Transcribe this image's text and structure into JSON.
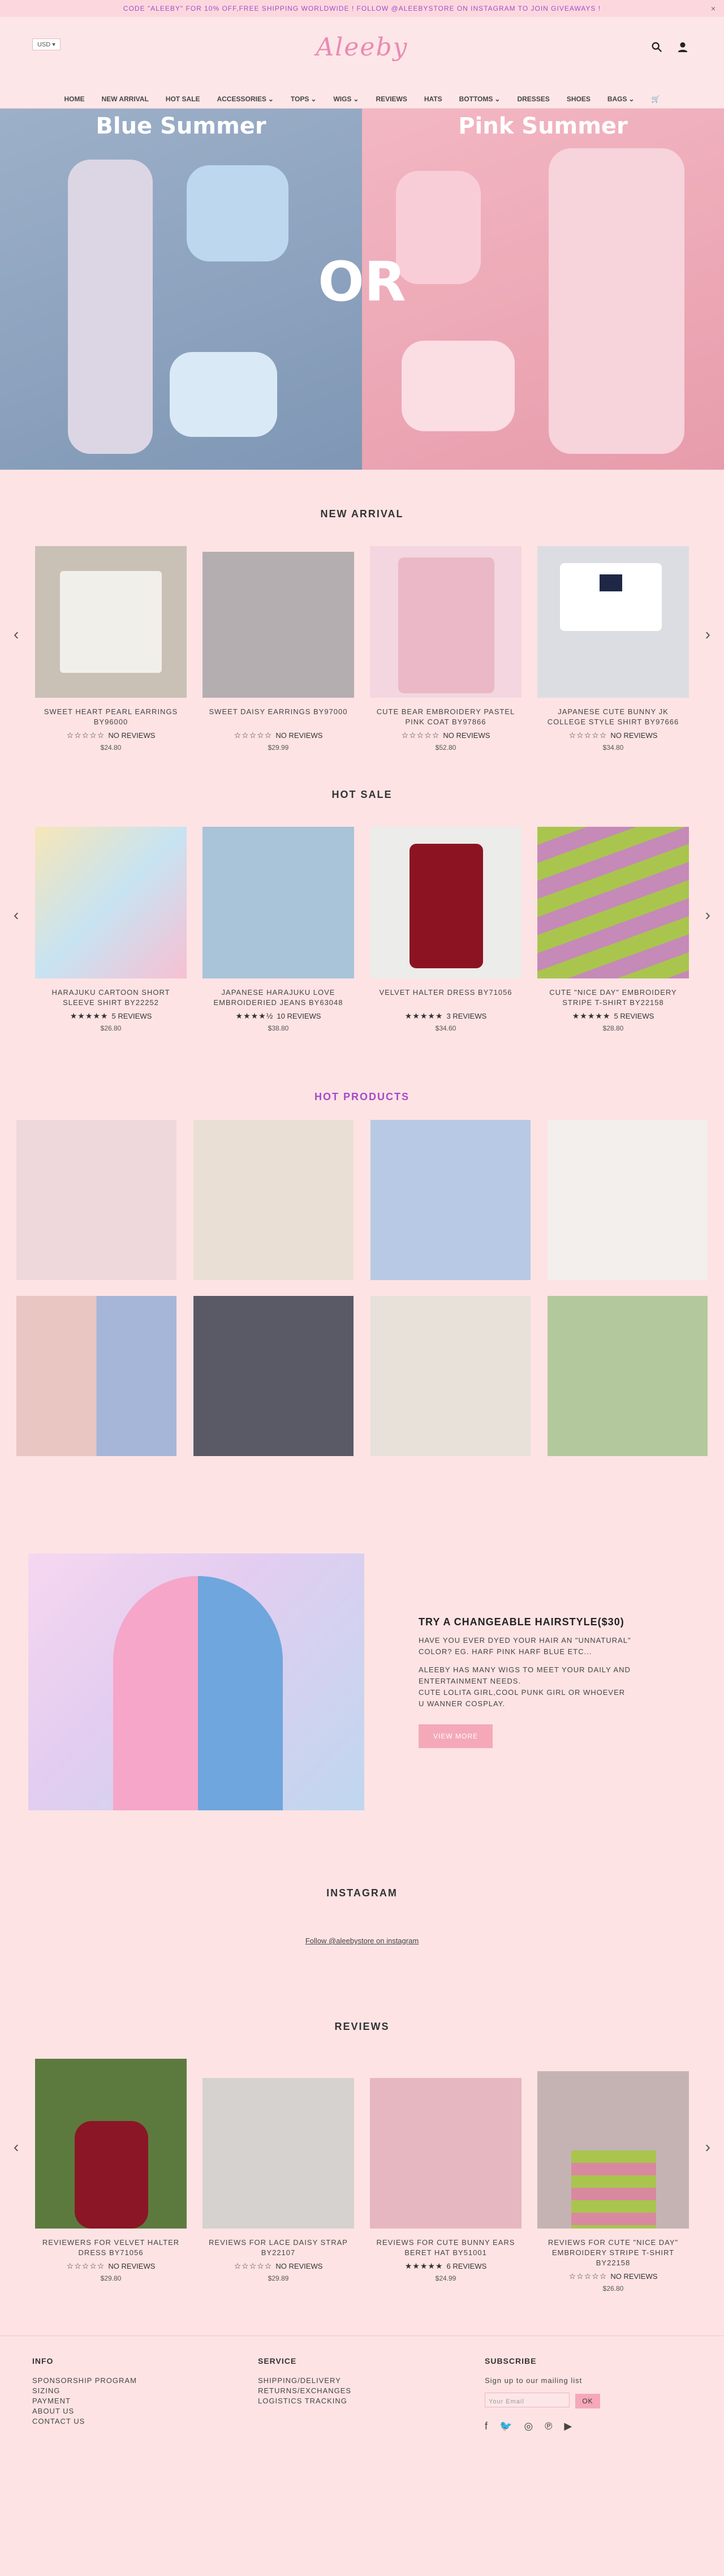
{
  "announce": {
    "text": "CODE \"ALEEBY\" FOR 10% OFF,FREE SHIPPING WORLDWIDE ! FOLLOW @ALEEBYSTORE ON INSTAGRAM TO JOIN GIVEAWAYS !",
    "close": "×"
  },
  "header": {
    "currency": "USD",
    "logo": "Aleeby"
  },
  "nav": {
    "items": [
      "HOME",
      "NEW ARRIVAL",
      "HOT SALE",
      "ACCESSORIES",
      "TOPS",
      "WIGS",
      "REVIEWS",
      "HATS",
      "BOTTOMS",
      "DRESSES",
      "SHOES",
      "BAGS"
    ]
  },
  "hero": {
    "left": "Blue Summer",
    "right": "Pink Summer",
    "or": "OR"
  },
  "new_arrival": {
    "title": "NEW ARRIVAL",
    "items": [
      {
        "name": "SWEET HEART PEARL EARRINGS BY96000",
        "reviews": "NO REVIEWS",
        "price": "$24.80"
      },
      {
        "name": "SWEET DAISY EARRINGS BY97000",
        "reviews": "NO REVIEWS",
        "price": "$29.99"
      },
      {
        "name": "CUTE BEAR EMBROIDERY PASTEL PINK COAT BY97866",
        "reviews": "NO REVIEWS",
        "price": "$52.80"
      },
      {
        "name": "JAPANESE CUTE BUNNY JK COLLEGE STYLE SHIRT BY97666",
        "reviews": "NO REVIEWS",
        "price": "$34.80"
      }
    ]
  },
  "hot_sale": {
    "title": "HOT SALE",
    "items": [
      {
        "name": "HARAJUKU CARTOON SHORT SLEEVE SHIRT BY22252",
        "reviews": "5 REVIEWS",
        "price": "$26.80"
      },
      {
        "name": "JAPANESE HARAJUKU LOVE EMBROIDERIED JEANS BY63048",
        "reviews": "10 REVIEWS",
        "price": "$38.80"
      },
      {
        "name": "VELVET HALTER DRESS BY71056",
        "reviews": "3 REVIEWS",
        "price": "$34.60"
      },
      {
        "name": "CUTE \"NICE DAY\" EMBROIDERY STRIPE T-SHIRT BY22158",
        "reviews": "5 REVIEWS",
        "price": "$28.80"
      }
    ]
  },
  "hot_products": {
    "title": "HOT PRODUCTS"
  },
  "hair": {
    "title": "TRY A CHANGEABLE HAIRSTYLE($30)",
    "p1": "HAVE YOU EVER DYED YOUR HAIR AN \"UNNATURAL\" COLOR? EG. HARF PINK HARF BLUE ETC...",
    "p2": "ALEEBY HAS MANY WIGS TO MEET YOUR DAILY AND ENTERTAINMENT NEEDS.",
    "p3": "CUTE LOLITA GIRL,COOL PUNK GIRL OR WHOEVER U WANNER COSPLAY.",
    "button": "VIEW MORE"
  },
  "instagram": {
    "title": "INSTAGRAM",
    "link": "Follow @aleebystore on instagram"
  },
  "reviews": {
    "title": "REVIEWS",
    "items": [
      {
        "name": "REVIEWERS FOR VELVET HALTER DRESS BY71056",
        "reviews": "NO REVIEWS",
        "price": "$29.80"
      },
      {
        "name": "REVIEWS FOR LACE DAISY STRAP BY22107",
        "reviews": "NO REVIEWS",
        "price": "$29.89"
      },
      {
        "name": "REVIEWS FOR CUTE BUNNY EARS BERET HAT BY51001",
        "reviews": "6 REVIEWS",
        "price": "$24.99"
      },
      {
        "name": "REVIEWS FOR CUTE \"NICE DAY\" EMBROIDERY STRIPE T-SHIRT BY22158",
        "reviews": "NO REVIEWS",
        "price": "$26.80"
      }
    ]
  },
  "footer": {
    "info": {
      "title": "INFO",
      "links": [
        "SPONSORSHIP PROGRAM",
        "SIZING",
        "PAYMENT",
        "ABOUT US",
        "CONTACT US"
      ]
    },
    "service": {
      "title": "SERVICE",
      "links": [
        "SHIPPING/DELIVERY",
        "RETURNS/EXCHANGES",
        "LOGISTICS TRACKING"
      ]
    },
    "subscribe": {
      "title": "SUBSCRIBE",
      "text": "Sign up to our mailing list",
      "placeholder": "Your Email",
      "button": "OK"
    }
  }
}
